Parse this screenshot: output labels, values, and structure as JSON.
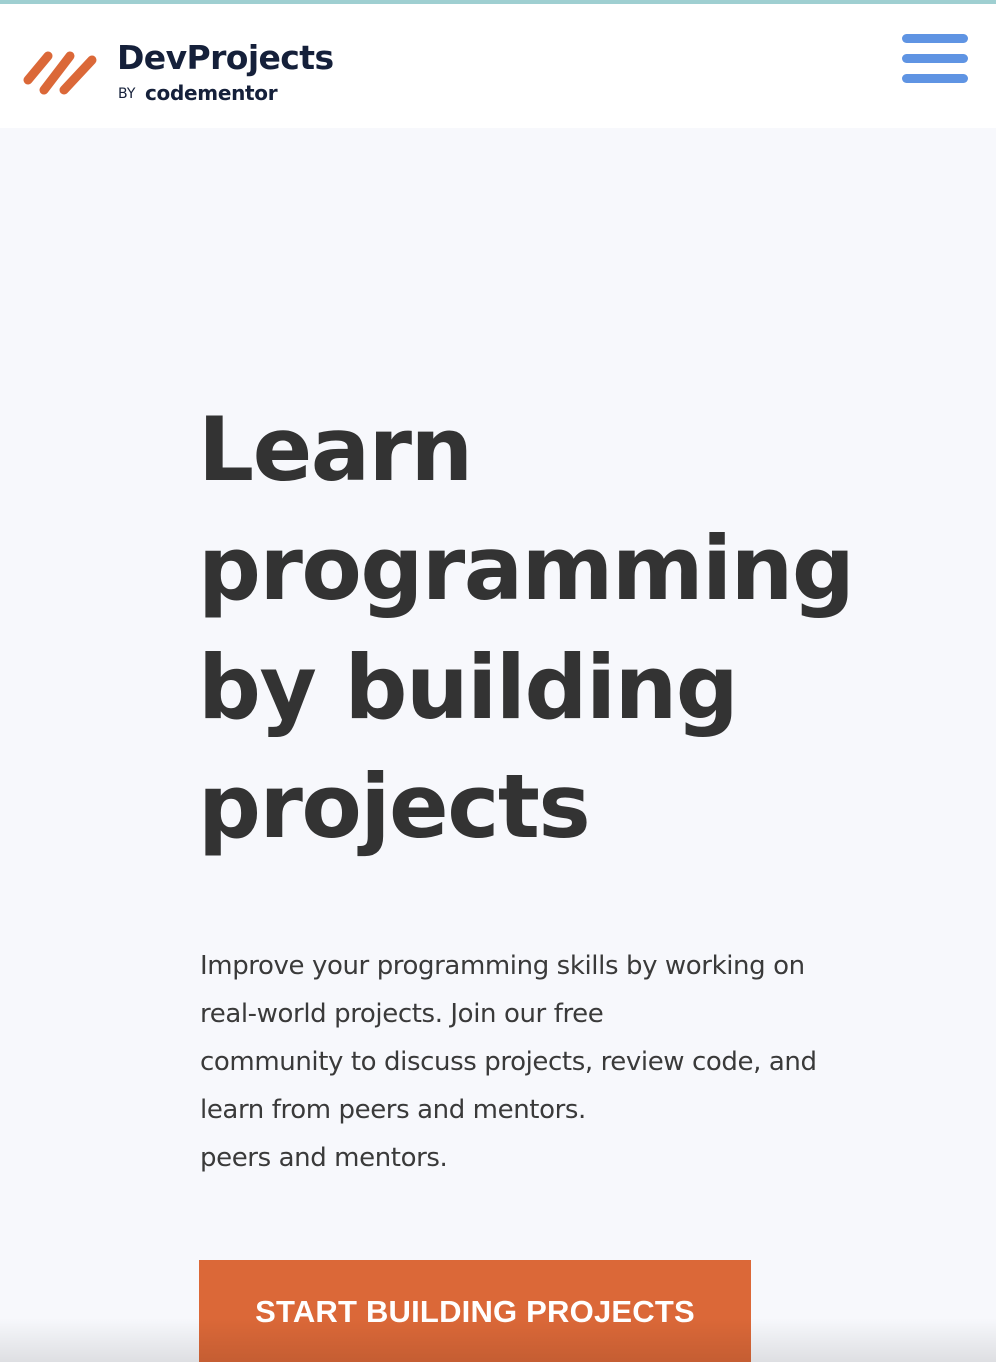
{
  "colors": {
    "brand_orange": "#db6838",
    "brand_navy": "#15203a",
    "menu_blue": "#5f94e3",
    "background": "#f7f8fc",
    "heading_text": "#333333"
  },
  "header": {
    "logo": {
      "icon": "diagonal-stripes-logo-icon",
      "name": "DevProjects",
      "by": "BY",
      "sub": "codementor"
    },
    "menu_icon": "hamburger-menu-icon"
  },
  "hero": {
    "title_lines": [
      "Learn",
      "programming",
      "by building",
      "projects"
    ],
    "description_lines": [
      "Improve your programming skills by working on",
      "real-world projects. Join our free",
      "community to discuss projects, review code, and",
      "learn from peers and mentors.",
      "peers and mentors."
    ],
    "cta_label": "START BUILDING PROJECTS"
  }
}
